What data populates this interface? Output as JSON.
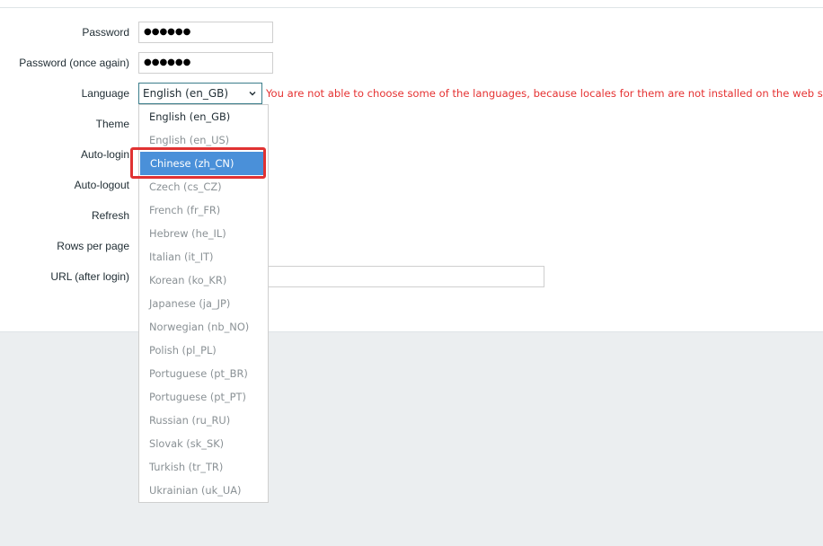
{
  "form": {
    "password": {
      "label": "Password",
      "value": "●●●●●●"
    },
    "password_again": {
      "label": "Password (once again)",
      "value": "●●●●●●"
    },
    "language": {
      "label": "Language",
      "value": "English (en_GB)",
      "warning": "You are not able to choose some of the languages, because locales for them are not installed on the web server."
    },
    "theme": {
      "label": "Theme"
    },
    "auto_login": {
      "label": "Auto-login"
    },
    "auto_logout": {
      "label": "Auto-logout"
    },
    "refresh": {
      "label": "Refresh"
    },
    "rows_per_page": {
      "label": "Rows per page"
    },
    "url_after_login": {
      "label": "URL (after login)",
      "value": ""
    }
  },
  "language_dropdown": {
    "options": [
      {
        "label": "English (en_GB)",
        "enabled": true
      },
      {
        "label": "English (en_US)",
        "enabled": false
      },
      {
        "label": "Chinese (zh_CN)",
        "enabled": true,
        "highlighted": true
      },
      {
        "label": "Czech (cs_CZ)",
        "enabled": false
      },
      {
        "label": "French (fr_FR)",
        "enabled": false
      },
      {
        "label": "Hebrew (he_IL)",
        "enabled": false
      },
      {
        "label": "Italian (it_IT)",
        "enabled": false
      },
      {
        "label": "Korean (ko_KR)",
        "enabled": false
      },
      {
        "label": "Japanese (ja_JP)",
        "enabled": false
      },
      {
        "label": "Norwegian (nb_NO)",
        "enabled": false
      },
      {
        "label": "Polish (pl_PL)",
        "enabled": false
      },
      {
        "label": "Portuguese (pt_BR)",
        "enabled": false
      },
      {
        "label": "Portuguese (pt_PT)",
        "enabled": false
      },
      {
        "label": "Russian (ru_RU)",
        "enabled": false
      },
      {
        "label": "Slovak (sk_SK)",
        "enabled": false
      },
      {
        "label": "Turkish (tr_TR)",
        "enabled": false
      },
      {
        "label": "Ukrainian (uk_UA)",
        "enabled": false
      }
    ]
  },
  "colors": {
    "warning": "#e53232",
    "selected_bg": "#4a90d9",
    "annotation": "#e03232",
    "focus_border": "#3b7d8b"
  },
  "icons": {
    "select_arrow": "chevron-down-icon"
  }
}
